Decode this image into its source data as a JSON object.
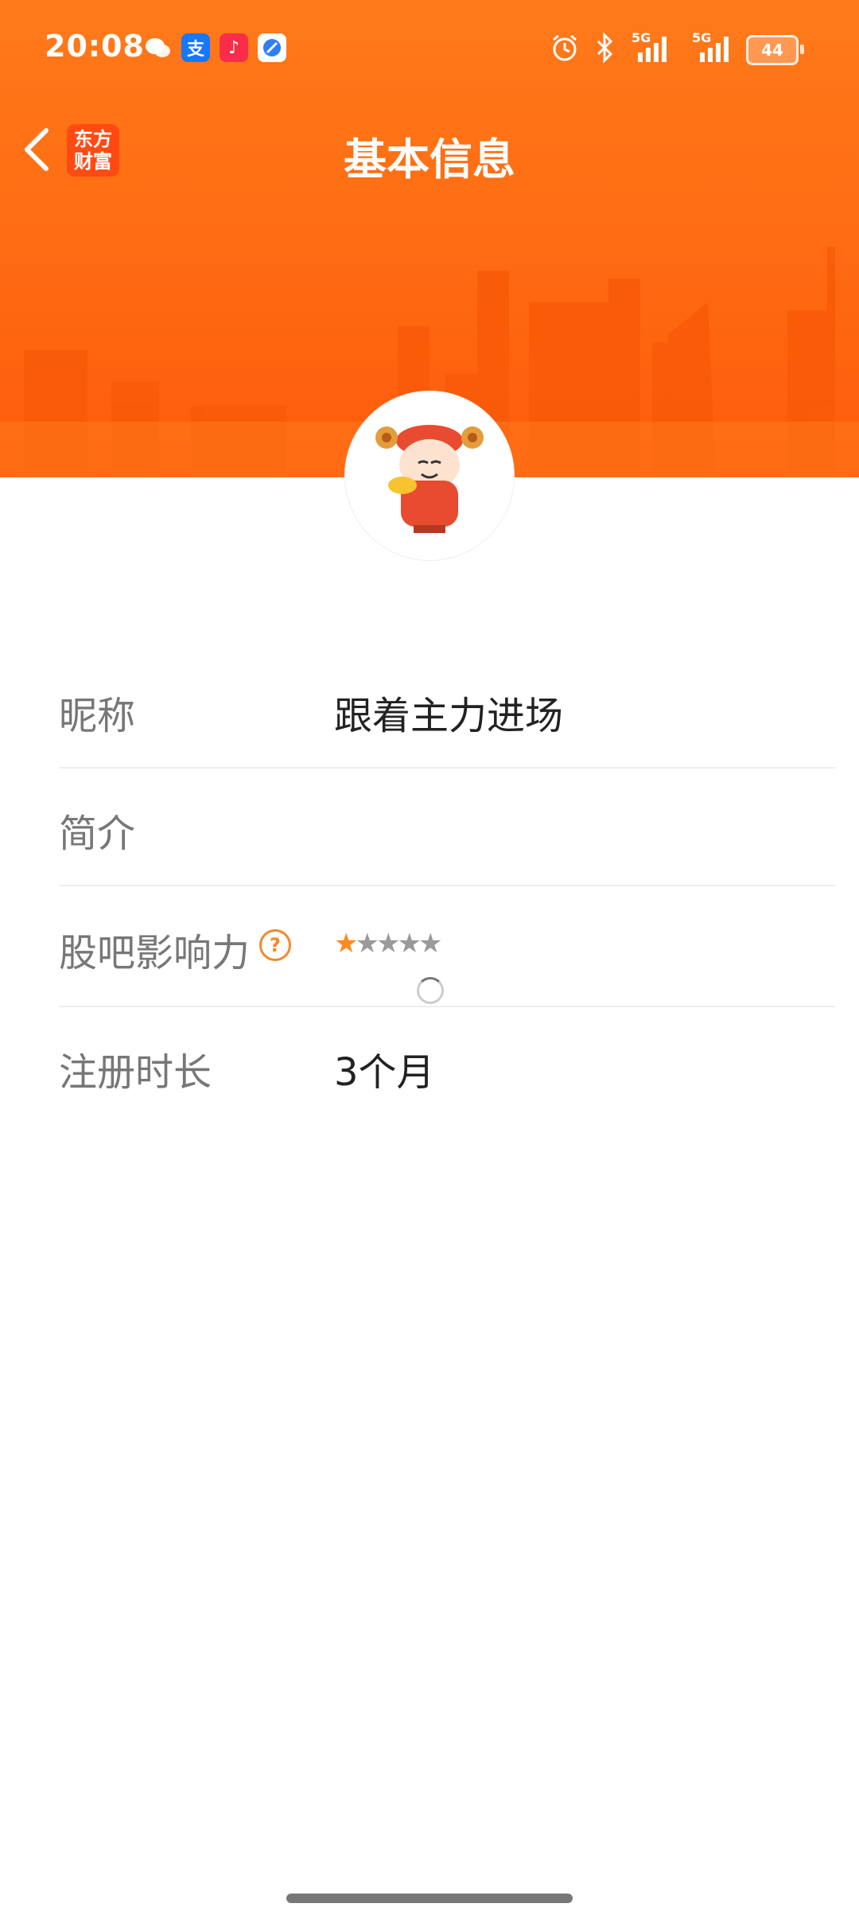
{
  "status_bar": {
    "time": "20:08",
    "alipay_glyph": "支",
    "battery": "44",
    "network_1": "5G",
    "network_2": "5G",
    "icons": [
      "wechat-icon",
      "alipay-icon",
      "music-icon",
      "browser-icon",
      "alarm-icon",
      "bluetooth-icon",
      "signal-icon",
      "battery-icon"
    ]
  },
  "nav": {
    "title": "基本信息",
    "logo_line1": "东方",
    "logo_line2": "财富"
  },
  "colors": {
    "accent": "#ff6a12",
    "star_on": "#ff8a1e",
    "star_off": "#9a9a9a",
    "label": "#777777",
    "value": "#222222"
  },
  "info": {
    "nickname": {
      "label": "昵称",
      "value": "跟着主力进场"
    },
    "bio": {
      "label": "简介",
      "value": ""
    },
    "influence": {
      "label": "股吧影响力",
      "help": "?",
      "rating": 1,
      "max": 5
    },
    "registration": {
      "label": "注册时长",
      "value": "3个月"
    }
  }
}
